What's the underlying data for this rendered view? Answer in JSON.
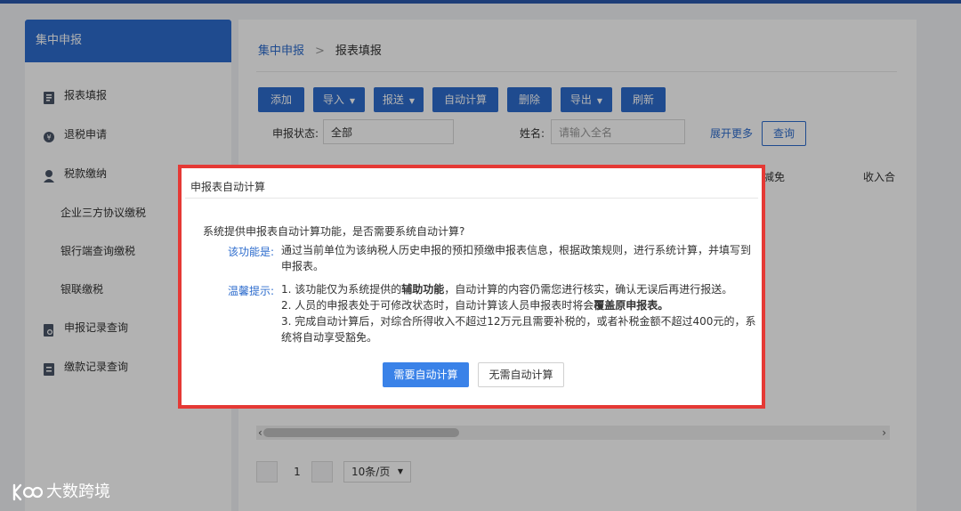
{
  "sidebar": {
    "title": "集中申报",
    "items": [
      {
        "label": "报表填报",
        "icon": "document-icon"
      },
      {
        "label": "退税申请",
        "icon": "refund-icon"
      },
      {
        "label": "税款缴纳",
        "icon": "user-pay-icon"
      },
      {
        "label": "申报记录查询",
        "icon": "record-search-icon"
      },
      {
        "label": "缴款记录查询",
        "icon": "payment-record-icon"
      }
    ],
    "subitems": [
      "企业三方协议缴税",
      "银行端查询缴税",
      "银联缴税"
    ]
  },
  "breadcrumb": {
    "parent": "集中申报",
    "separator": ">",
    "current": "报表填报"
  },
  "toolbar": {
    "add": "添加",
    "import": "导入",
    "submit": "报送",
    "auto_calc": "自动计算",
    "delete": "删除",
    "export": "导出",
    "refresh": "刷新"
  },
  "filters": {
    "status_label": "申报状态:",
    "status_value": "全部",
    "name_label": "姓名:",
    "name_placeholder": "请输入全名",
    "expand_more": "展开更多",
    "query": "查询"
  },
  "table": {
    "header_partial_1": "减免",
    "header_partial_2": "收入合"
  },
  "pagination": {
    "current_page": "1",
    "page_size": "10条/页"
  },
  "dialog": {
    "title": "申报表自动计算",
    "question": "系统提供申报表自动计算功能，是否需要系统自动计算?",
    "func_label": "该功能是:",
    "func_line1": "通过当前单位为该纳税人历史申报的预扣预缴申报表信息，根据政策规则，进行系统计算，并填写到",
    "func_line2": "申报表。",
    "tip_label": "温馨提示:",
    "tip1_a": "1. 该功能仅为系统提供的",
    "tip1_b": "辅助功能",
    "tip1_c": "，自动计算的内容仍需您进行核实，确认无误后再进行报送。",
    "tip2_a": "2. 人员的申报表处于可修改状态时，自动计算该人员申报表时将会",
    "tip2_b": "覆盖原申报表。",
    "tip3_line1": "3. 完成自动计算后，对综合所得收入不超过12万元且需要补税的，或者补税金额不超过400元的，系",
    "tip3_line2": "统将自动享受豁免。",
    "confirm": "需要自动计算",
    "cancel": "无需自动计算"
  },
  "watermark": {
    "text": "大数跨境"
  },
  "colors": {
    "accent": "#2d6ccd",
    "highlight_border": "#e53935",
    "primary_button": "#3a82e8"
  }
}
